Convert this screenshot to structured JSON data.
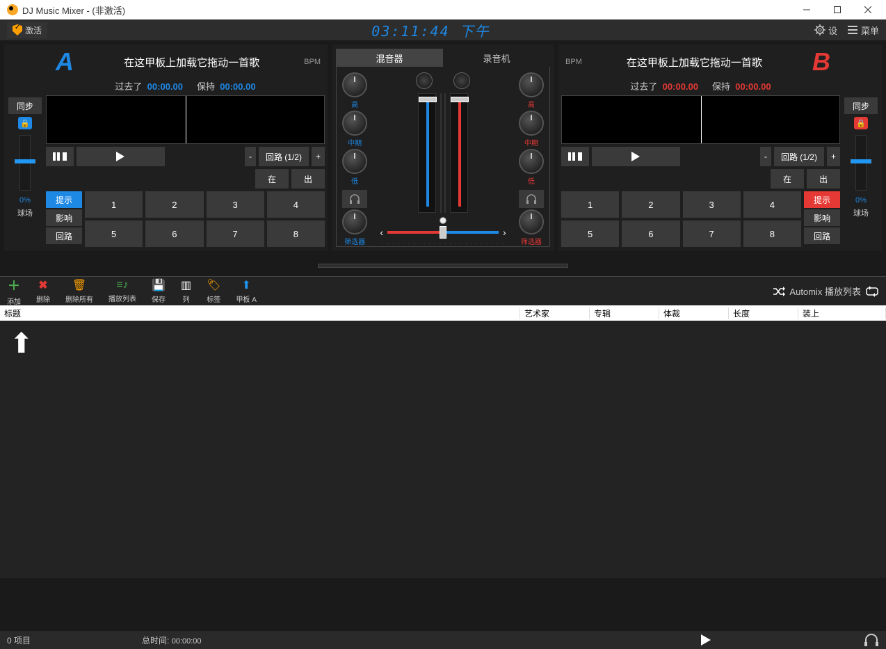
{
  "title": "DJ Music Mixer  -  (非激活)",
  "topbar": {
    "activate": "激活",
    "clock": "03:11:44 下午",
    "settings": "设",
    "menu": "菜单"
  },
  "deck": {
    "sync": "同步",
    "pitch_label": "球场",
    "load_hint": "在这甲板上加载它拖动一首歌",
    "bpm": "BPM",
    "elapsed": "过去了",
    "remain": "保持",
    "time": "00:00.00",
    "loop": "回路 (1/2)",
    "in": "在",
    "out": "出",
    "tabs": [
      "提示",
      "影响",
      "回路"
    ],
    "pads": [
      "1",
      "2",
      "3",
      "4",
      "5",
      "6",
      "7",
      "8"
    ],
    "pctA": "0%",
    "pctB": "0%"
  },
  "mixer": {
    "tab_mix": "混音器",
    "tab_rec": "录音机",
    "eq": {
      "high": "高",
      "mid": "中期",
      "low": "低",
      "filter": "筛选器"
    }
  },
  "lib": {
    "add": "添加",
    "del": "删除",
    "delall": "删除所有",
    "playlist": "播放列表",
    "save": "保存",
    "col": "列",
    "tag": "标签",
    "deckA": "甲板 A",
    "automix": "Automix 播放列表",
    "cols": {
      "title": "标题",
      "artist": "艺术家",
      "album": "专辑",
      "genre": "体裁",
      "length": "长度",
      "load": "装上"
    }
  },
  "status": {
    "items": "0 项目",
    "total": "总时间:",
    "total_time": "00:00:00"
  }
}
